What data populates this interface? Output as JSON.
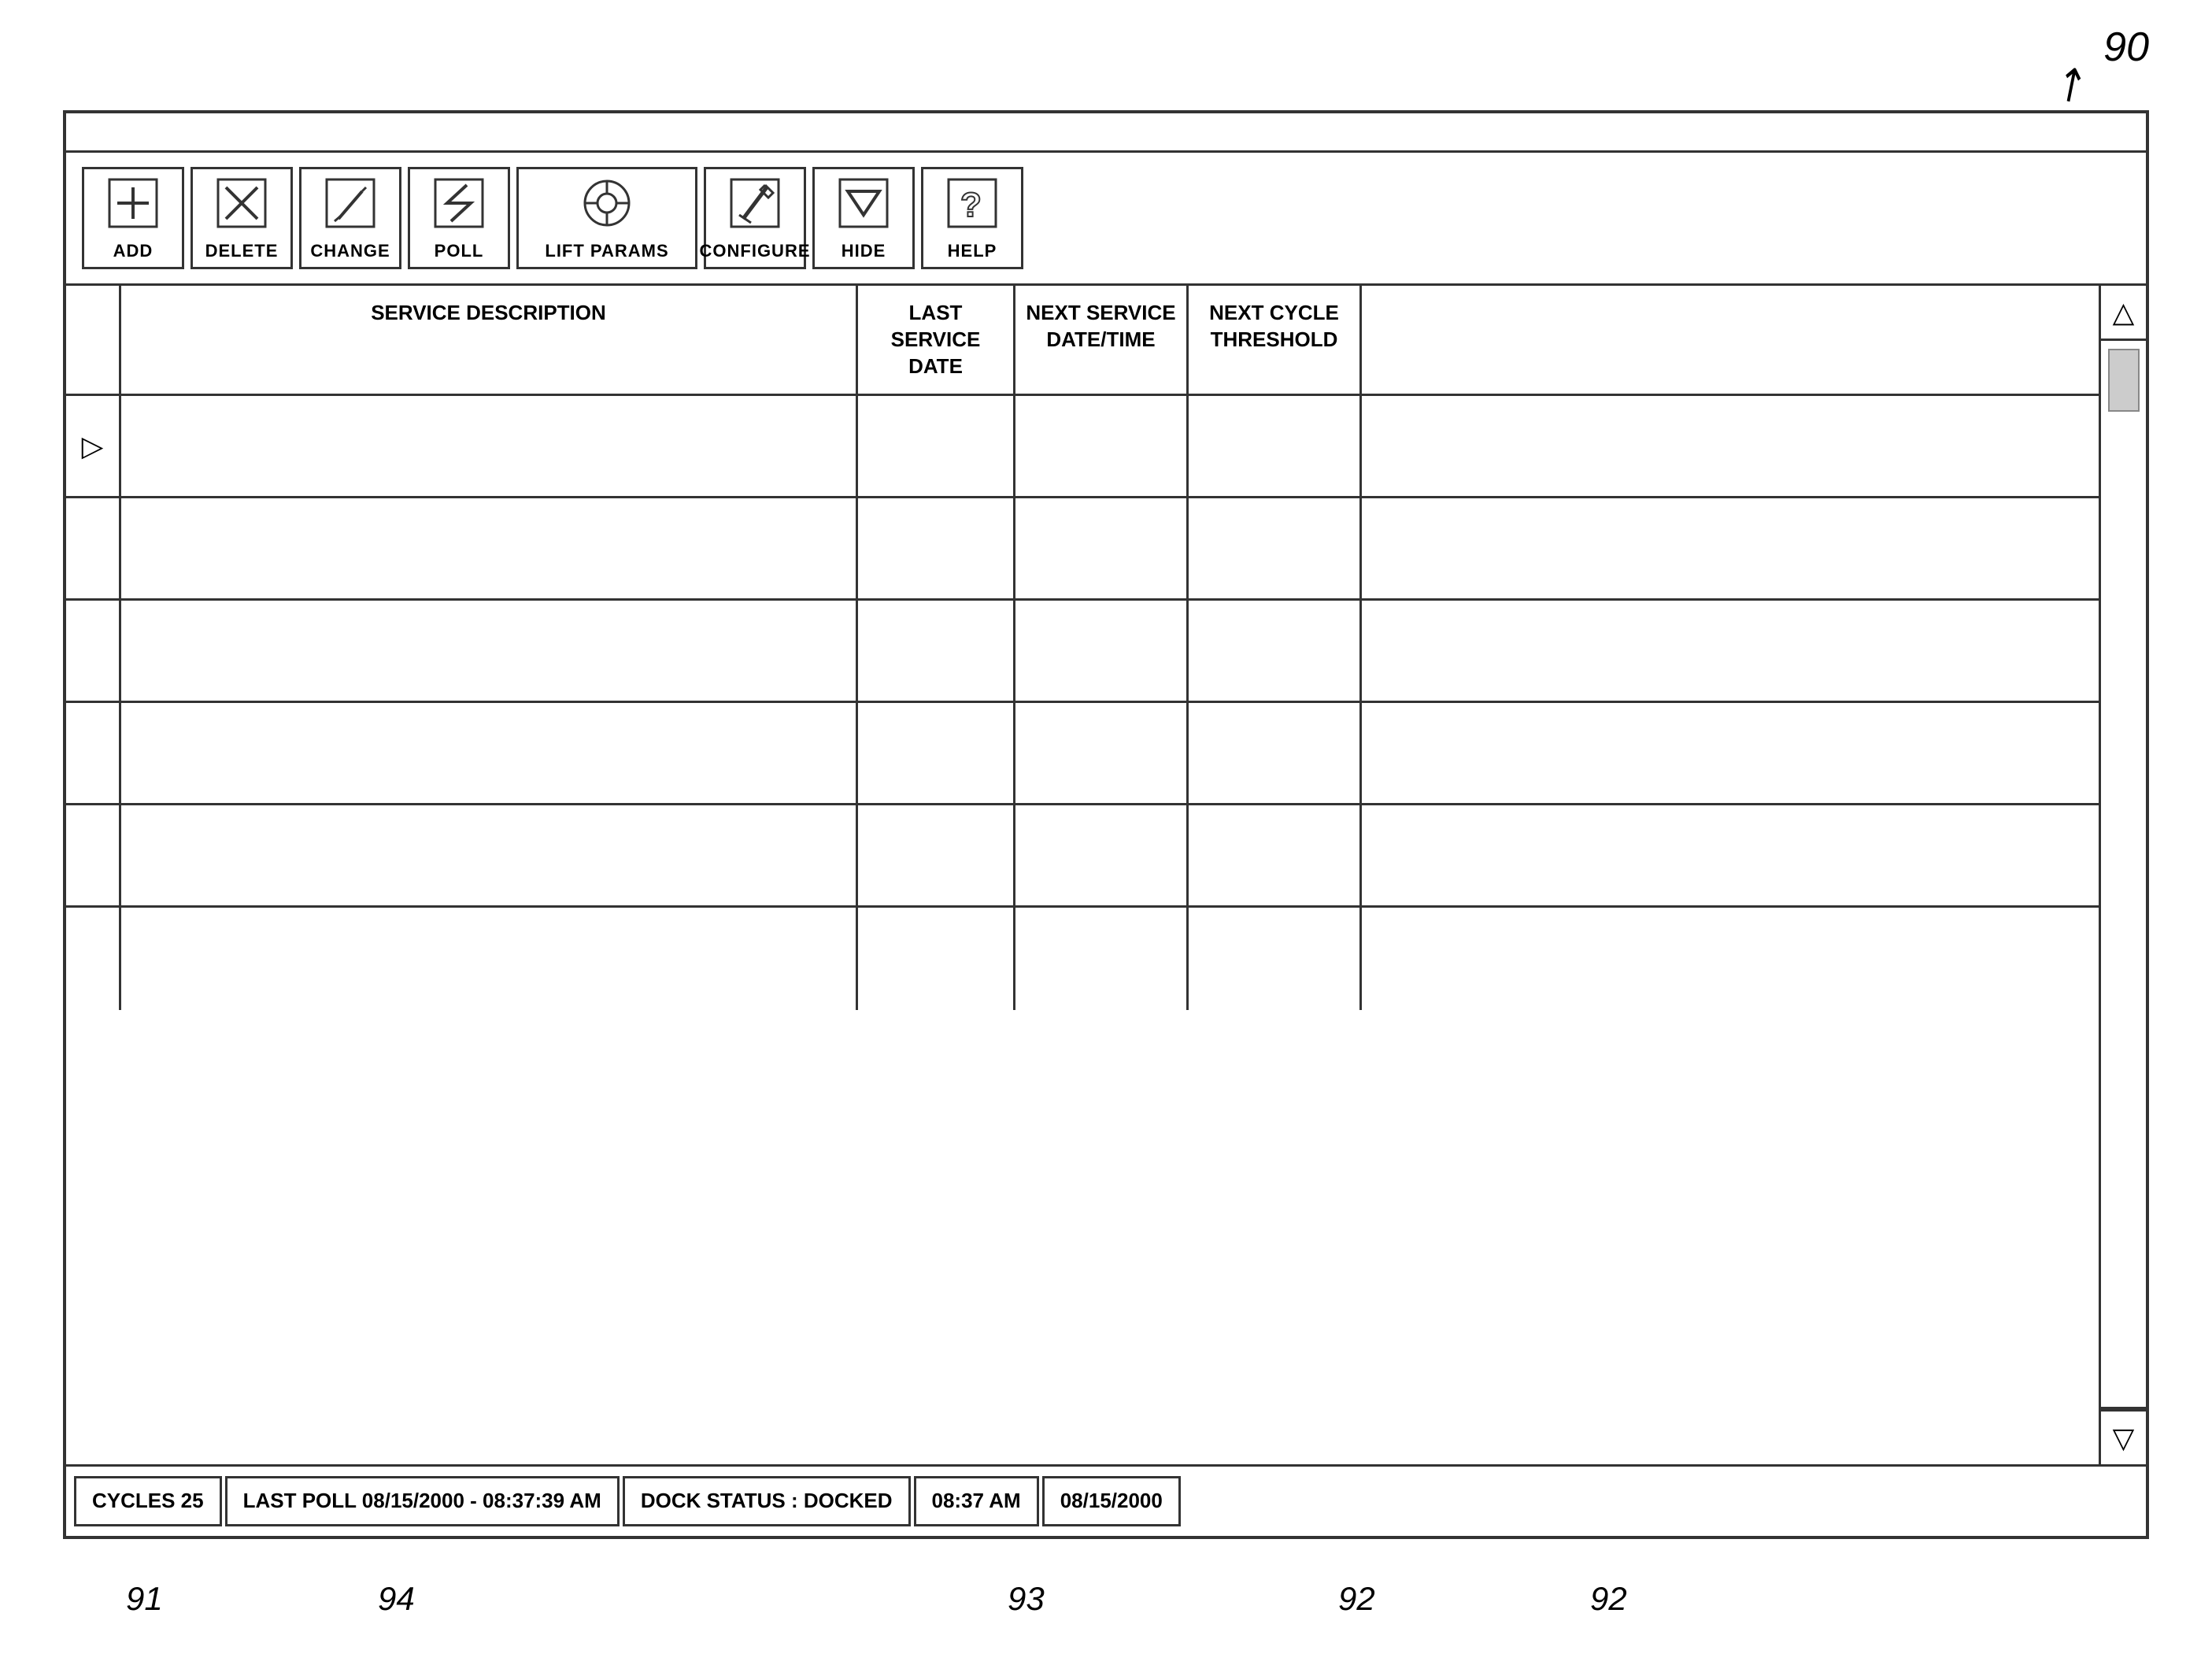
{
  "app": {
    "ref_number": "90",
    "title": ""
  },
  "toolbar": {
    "buttons": [
      {
        "id": "add",
        "label": "ADD",
        "icon": "add"
      },
      {
        "id": "delete",
        "label": "DELETE",
        "icon": "delete"
      },
      {
        "id": "change",
        "label": "CHANGE",
        "icon": "change"
      },
      {
        "id": "poll",
        "label": "POLL",
        "icon": "poll"
      },
      {
        "id": "lift_params",
        "label": "LIFT PARAMS",
        "icon": "lift_params",
        "wide": true
      },
      {
        "id": "configure",
        "label": "CONFIGURE",
        "icon": "configure"
      },
      {
        "id": "hide",
        "label": "HIDE",
        "icon": "hide"
      },
      {
        "id": "help",
        "label": "HELP",
        "icon": "help"
      }
    ]
  },
  "table": {
    "columns": [
      {
        "id": "indicator",
        "label": ""
      },
      {
        "id": "service_description",
        "label": "SERVICE DESCRIPTION"
      },
      {
        "id": "last_service_date",
        "label": "LAST SERVICE\nDATE"
      },
      {
        "id": "next_service_datetime",
        "label": "NEXT SERVICE\nDATE/TIME"
      },
      {
        "id": "next_cycle_threshold",
        "label": "NEXT CYCLE\nTHRESHOLD"
      },
      {
        "id": "extra",
        "label": ""
      }
    ],
    "rows": [
      {
        "indicator": "▷",
        "cells": [
          "",
          "",
          "",
          "",
          ""
        ]
      },
      {
        "indicator": "",
        "cells": [
          "",
          "",
          "",
          "",
          ""
        ]
      },
      {
        "indicator": "",
        "cells": [
          "",
          "",
          "",
          "",
          ""
        ]
      },
      {
        "indicator": "",
        "cells": [
          "",
          "",
          "",
          "",
          ""
        ]
      },
      {
        "indicator": "",
        "cells": [
          "",
          "",
          "",
          "",
          ""
        ]
      },
      {
        "indicator": "",
        "cells": [
          "",
          "",
          "",
          "",
          ""
        ]
      }
    ]
  },
  "status_bar": {
    "cycles": "CYCLES 25",
    "last_poll": "LAST POLL 08/15/2000 - 08:37:39 AM",
    "dock_status": "DOCK STATUS : DOCKED",
    "time": "08:37 AM",
    "date": "08/15/2000"
  },
  "ref_labels": [
    {
      "id": "91",
      "label": "91"
    },
    {
      "id": "94",
      "label": "94"
    },
    {
      "id": "93",
      "label": "93"
    },
    {
      "id": "92a",
      "label": "92"
    },
    {
      "id": "92b",
      "label": "92"
    }
  ]
}
